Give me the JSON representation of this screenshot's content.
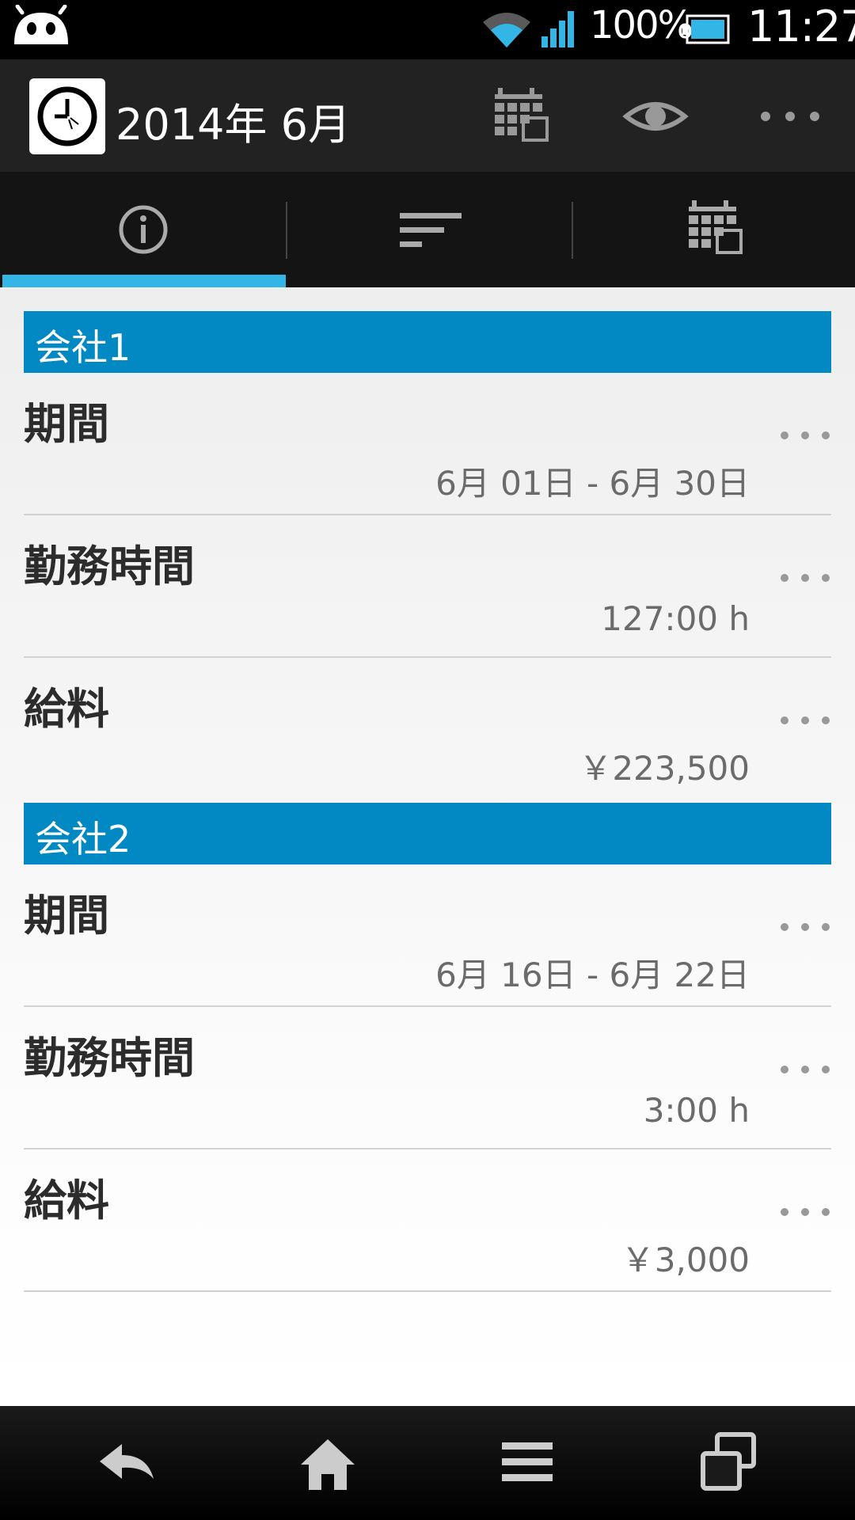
{
  "status_bar": {
    "battery_text": "100%",
    "clock": "11:27"
  },
  "action_bar": {
    "title": "2014年 6月",
    "icons": [
      "clock-icon",
      "calendar-grid-icon",
      "eye-icon",
      "overflow-menu-icon"
    ]
  },
  "tabs": [
    {
      "icon": "info-icon",
      "selected": true
    },
    {
      "icon": "sort-list-icon",
      "selected": false
    },
    {
      "icon": "calendar-grid-icon",
      "selected": false
    }
  ],
  "sections": [
    {
      "title": "会社1",
      "rows": [
        {
          "label": "期間",
          "value": "6月 01日  -  6月 30日"
        },
        {
          "label": "勤務時間",
          "value": "127:00 h"
        },
        {
          "label": "給料",
          "value": "￥223,500"
        }
      ]
    },
    {
      "title": "会社2",
      "rows": [
        {
          "label": "期間",
          "value": "6月 16日  -  6月 22日"
        },
        {
          "label": "勤務時間",
          "value": "3:00 h"
        },
        {
          "label": "給料",
          "value": "￥3,000"
        }
      ]
    }
  ],
  "nav_bar": [
    "back-icon",
    "home-icon",
    "menu-icon",
    "recent-apps-icon"
  ],
  "colors": {
    "section_header": "#0288c2",
    "tab_indicator": "#33b5e5",
    "action_bar": "#222222"
  }
}
